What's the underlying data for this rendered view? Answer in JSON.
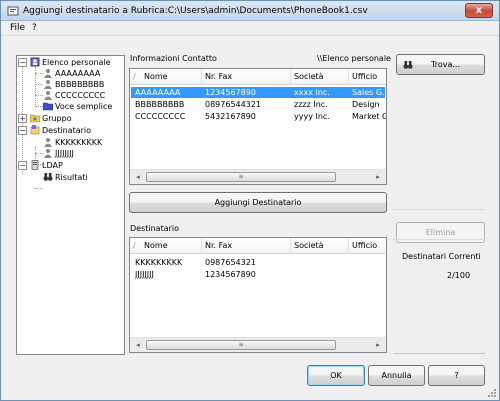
{
  "window": {
    "title": "Aggiungi destinatario a Rubrica:C:\\Users\\admin\\Documents\\PhoneBook1.csv",
    "close": "x"
  },
  "menu": {
    "file": "File",
    "help": "?"
  },
  "tree": {
    "personal": "Elenco personale",
    "personal_items": [
      "AAAAAAAA",
      "BBBBBBBBB",
      "CCCCCCCCC"
    ],
    "simple_item": "Voce semplice",
    "group": "Gruppo",
    "recipient": "Destinatario",
    "recipient_items": [
      "KKKKKKKKK",
      "JJJJJJJJ"
    ],
    "ldap": "LDAP",
    "results": "Risultati",
    "expanded": "−"
  },
  "contact_info": {
    "label": "Informazioni Contatto",
    "path": "\\\\Elenco personale",
    "columns": [
      "Nome",
      "Nr. Fax",
      "Società",
      "Ufficio"
    ],
    "rows": [
      [
        "AAAAAAAA",
        "1234567890",
        "xxxx Inc.",
        "Sales G."
      ],
      [
        "BBBBBBBBB",
        "08976544321",
        "zzzz Inc.",
        "Design"
      ],
      [
        "CCCCCCCCC",
        "5432167890",
        "yyyy Inc.",
        "Market G."
      ]
    ]
  },
  "find_button": "Trova...",
  "add_button": "Aggiungi Destinatario",
  "recipients": {
    "label": "Destinatario",
    "columns": [
      "Nome",
      "Nr. Fax",
      "Società",
      "Ufficio"
    ],
    "rows": [
      [
        "KKKKKKKKK",
        "0987654321",
        "",
        ""
      ],
      [
        "JJJJJJJJ",
        "1234567890",
        "",
        ""
      ]
    ]
  },
  "delete_button": "Elimina",
  "current_recipients_label": "Destinatari Correnti",
  "current_recipients_count": "2/100",
  "ok_button": "OK",
  "cancel_button": "Annulla",
  "help_button": "?",
  "scroll": {
    "left": "◂",
    "right": "▸",
    "grip": "≡"
  },
  "colors": {
    "selection": "#3399ff",
    "title_gradient_top": "#dbe8f5",
    "close_red": "#c9473a"
  }
}
